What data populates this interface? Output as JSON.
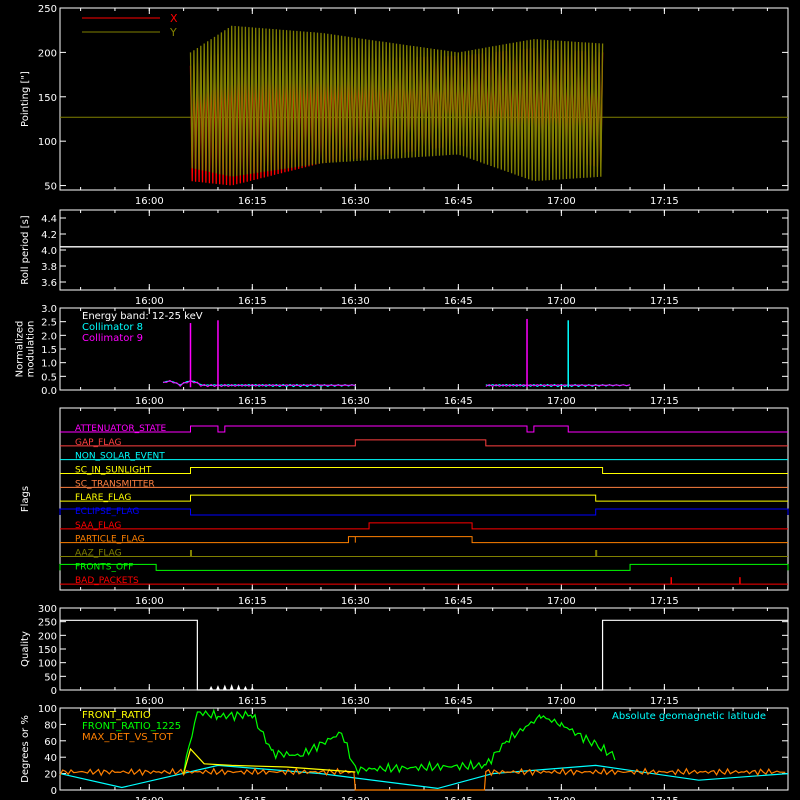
{
  "figure": {
    "background": "#000000",
    "axis_color": "#ffffff",
    "time_axis": {
      "domain": [
        "15:47",
        "17:33"
      ],
      "ticks": [
        "16:00",
        "16:15",
        "16:30",
        "16:45",
        "17:00",
        "17:15"
      ],
      "minor_every_min": 5
    }
  },
  "chart_data": [
    {
      "id": "pointing",
      "type": "line",
      "ylabel": "Pointing [\"]",
      "ylim": [
        45,
        250
      ],
      "yticks": [
        50,
        100,
        150,
        200,
        250
      ],
      "legend": [
        {
          "name": "X",
          "color": "#ff0000"
        },
        {
          "name": "Y",
          "color": "#808000"
        }
      ],
      "baseline_value": 127,
      "series": [
        {
          "name": "X",
          "color": "#ff0000",
          "envelope_x": [
            "16:06",
            "16:12",
            "16:25",
            "16:45",
            "16:56",
            "17:06"
          ],
          "upper": [
            185,
            205,
            192,
            196,
            205,
            200
          ],
          "lower": [
            55,
            50,
            75,
            95,
            85,
            70
          ]
        },
        {
          "name": "Y",
          "color": "#808000",
          "envelope_x": [
            "16:06",
            "16:12",
            "16:25",
            "16:45",
            "16:56",
            "17:06"
          ],
          "upper": [
            200,
            230,
            222,
            200,
            215,
            210
          ],
          "lower": [
            70,
            60,
            75,
            85,
            55,
            60
          ]
        }
      ],
      "active_range": [
        "16:06",
        "17:06"
      ]
    },
    {
      "id": "roll",
      "type": "line",
      "ylabel": "Roll period [s]",
      "ylim": [
        3.5,
        4.5
      ],
      "yticks": [
        "3.6",
        "3.8",
        "4.0",
        "4.2",
        "4.4"
      ],
      "series": [
        {
          "name": "",
          "color": "#ffffff",
          "x": [
            "15:47",
            "17:33"
          ],
          "y": [
            4.04,
            4.04
          ]
        }
      ]
    },
    {
      "id": "modulation",
      "type": "line",
      "ylabel": [
        "Normalized",
        "modulation"
      ],
      "ylim": [
        0,
        3.0
      ],
      "yticks": [
        "0.0",
        "0.5",
        "1.0",
        "1.5",
        "2.0",
        "2.5",
        "3.0"
      ],
      "legend": [
        {
          "name": "Energy band: 12-25 keV",
          "color": "#ffffff"
        },
        {
          "name": "Collimator 8",
          "color": "#00ffff"
        },
        {
          "name": "Collimator 9",
          "color": "#ff00ff"
        }
      ],
      "segments": [
        [
          "16:02",
          "16:30"
        ],
        [
          "16:49",
          "17:10"
        ]
      ],
      "spikes": [
        {
          "x": "16:06",
          "y": 2.45,
          "color": "#ff00ff"
        },
        {
          "x": "16:10",
          "y": 2.55,
          "color": "#ff00ff"
        },
        {
          "x": "16:55",
          "y": 2.6,
          "color": "#ff00ff"
        },
        {
          "x": "17:01",
          "y": 2.55,
          "color": "#00ffff"
        }
      ]
    },
    {
      "id": "flags",
      "type": "table",
      "ylabel": "Flags",
      "rows": [
        {
          "name": "ATTENUATOR_STATE",
          "color": "#ff00ff",
          "high": [
            [
              "16:06",
              "16:10"
            ],
            [
              "16:11",
              "16:55"
            ],
            [
              "16:56",
              "17:01"
            ]
          ]
        },
        {
          "name": "GAP_FLAG",
          "color": "#ff4040",
          "high": [
            [
              "16:30",
              "16:49"
            ]
          ]
        },
        {
          "name": "NON_SOLAR_EVENT",
          "color": "#00ffff",
          "high": []
        },
        {
          "name": "SC_IN_SUNLIGHT",
          "color": "#ffff00",
          "high": [
            [
              "16:06",
              "17:06"
            ]
          ]
        },
        {
          "name": "SC_TRANSMITTER",
          "color": "#ff8040",
          "high": []
        },
        {
          "name": "FLARE_FLAG",
          "color": "#ffff00",
          "high": [
            [
              "16:06",
              "17:05"
            ]
          ]
        },
        {
          "name": "ECLIPSE_FLAG",
          "color": "#0000ff",
          "high": [
            [
              "15:47",
              "16:06"
            ],
            [
              "17:05",
              "17:33"
            ]
          ]
        },
        {
          "name": "SAA_FLAG",
          "color": "#ff0000",
          "high": [
            [
              "16:32",
              "16:47"
            ]
          ]
        },
        {
          "name": "PARTICLE_FLAG",
          "color": "#ff8000",
          "high": [
            [
              "16:29",
              "16:30"
            ],
            [
              "16:30",
              "16:47"
            ]
          ]
        },
        {
          "name": "AAZ_FLAG",
          "color": "#808000",
          "high": [
            [
              "16:06",
              "16:06"
            ],
            [
              "17:05",
              "17:05"
            ]
          ]
        },
        {
          "name": "FRONTS_OFF",
          "color": "#00ff00",
          "high": [
            [
              "15:47",
              "16:01"
            ],
            [
              "17:10",
              "17:33"
            ]
          ]
        },
        {
          "name": "BAD_PACKETS",
          "color": "#ff0000",
          "high": [],
          "spikes": [
            "17:16",
            "17:26"
          ]
        }
      ]
    },
    {
      "id": "quality",
      "type": "line",
      "ylabel": "Quality",
      "ylim": [
        0,
        300
      ],
      "yticks": [
        0,
        50,
        100,
        150,
        200,
        250,
        300
      ],
      "series": [
        {
          "name": "",
          "color": "#ffffff",
          "x": [
            "15:47",
            "16:07",
            "16:07",
            "17:06",
            "17:06",
            "17:33"
          ],
          "y": [
            255,
            255,
            0,
            0,
            255,
            255
          ]
        }
      ],
      "small_peaks": [
        {
          "x": "16:09",
          "y": 15
        },
        {
          "x": "16:10",
          "y": 18
        },
        {
          "x": "16:11",
          "y": 20
        },
        {
          "x": "16:12",
          "y": 22
        },
        {
          "x": "16:13",
          "y": 20
        },
        {
          "x": "16:14",
          "y": 15
        },
        {
          "x": "16:15",
          "y": 10
        }
      ]
    },
    {
      "id": "ratios",
      "type": "line",
      "ylabel": "Degrees or %",
      "ylim": [
        0,
        100
      ],
      "yticks": [
        0,
        20,
        40,
        60,
        80,
        100
      ],
      "legend": [
        {
          "name": "FRONT_RATIO",
          "color": "#ffff00"
        },
        {
          "name": "FRONT_RATIO_1225",
          "color": "#00ff00"
        },
        {
          "name": "MAX_DET_VS_TOT",
          "color": "#ff8000"
        }
      ],
      "annotation": {
        "text": "Absolute geomagnetic latitude",
        "color": "#00ffff"
      },
      "series": [
        {
          "name": "Absolute geomagnetic latitude",
          "color": "#00ffff",
          "x": [
            "15:47",
            "15:56",
            "16:10",
            "16:25",
            "16:42",
            "16:50",
            "17:05",
            "17:20",
            "17:33"
          ],
          "y": [
            20,
            3,
            30,
            20,
            2,
            20,
            30,
            12,
            20
          ]
        },
        {
          "name": "MAX_DET_VS_TOT",
          "color": "#ff8000",
          "x": [
            "15:47",
            "16:30",
            "16:30",
            "16:49",
            "16:49",
            "17:33"
          ],
          "y": [
            22,
            22,
            0,
            0,
            22,
            22
          ]
        },
        {
          "name": "FRONT_RATIO_1225",
          "color": "#00ff00",
          "x": [
            "16:05",
            "16:07",
            "16:10",
            "16:15",
            "16:18",
            "16:22",
            "16:28",
            "16:30",
            "16:49",
            "16:52",
            "16:57",
            "17:00",
            "17:05",
            "17:08"
          ],
          "y": [
            25,
            95,
            90,
            92,
            45,
            42,
            70,
            25,
            30,
            60,
            90,
            80,
            55,
            40
          ]
        },
        {
          "name": "FRONT_RATIO",
          "color": "#ffff00",
          "x": [
            "16:05",
            "16:06",
            "16:08",
            "16:12",
            "16:20",
            "16:30"
          ],
          "y": [
            20,
            50,
            32,
            30,
            28,
            22
          ]
        }
      ]
    }
  ]
}
